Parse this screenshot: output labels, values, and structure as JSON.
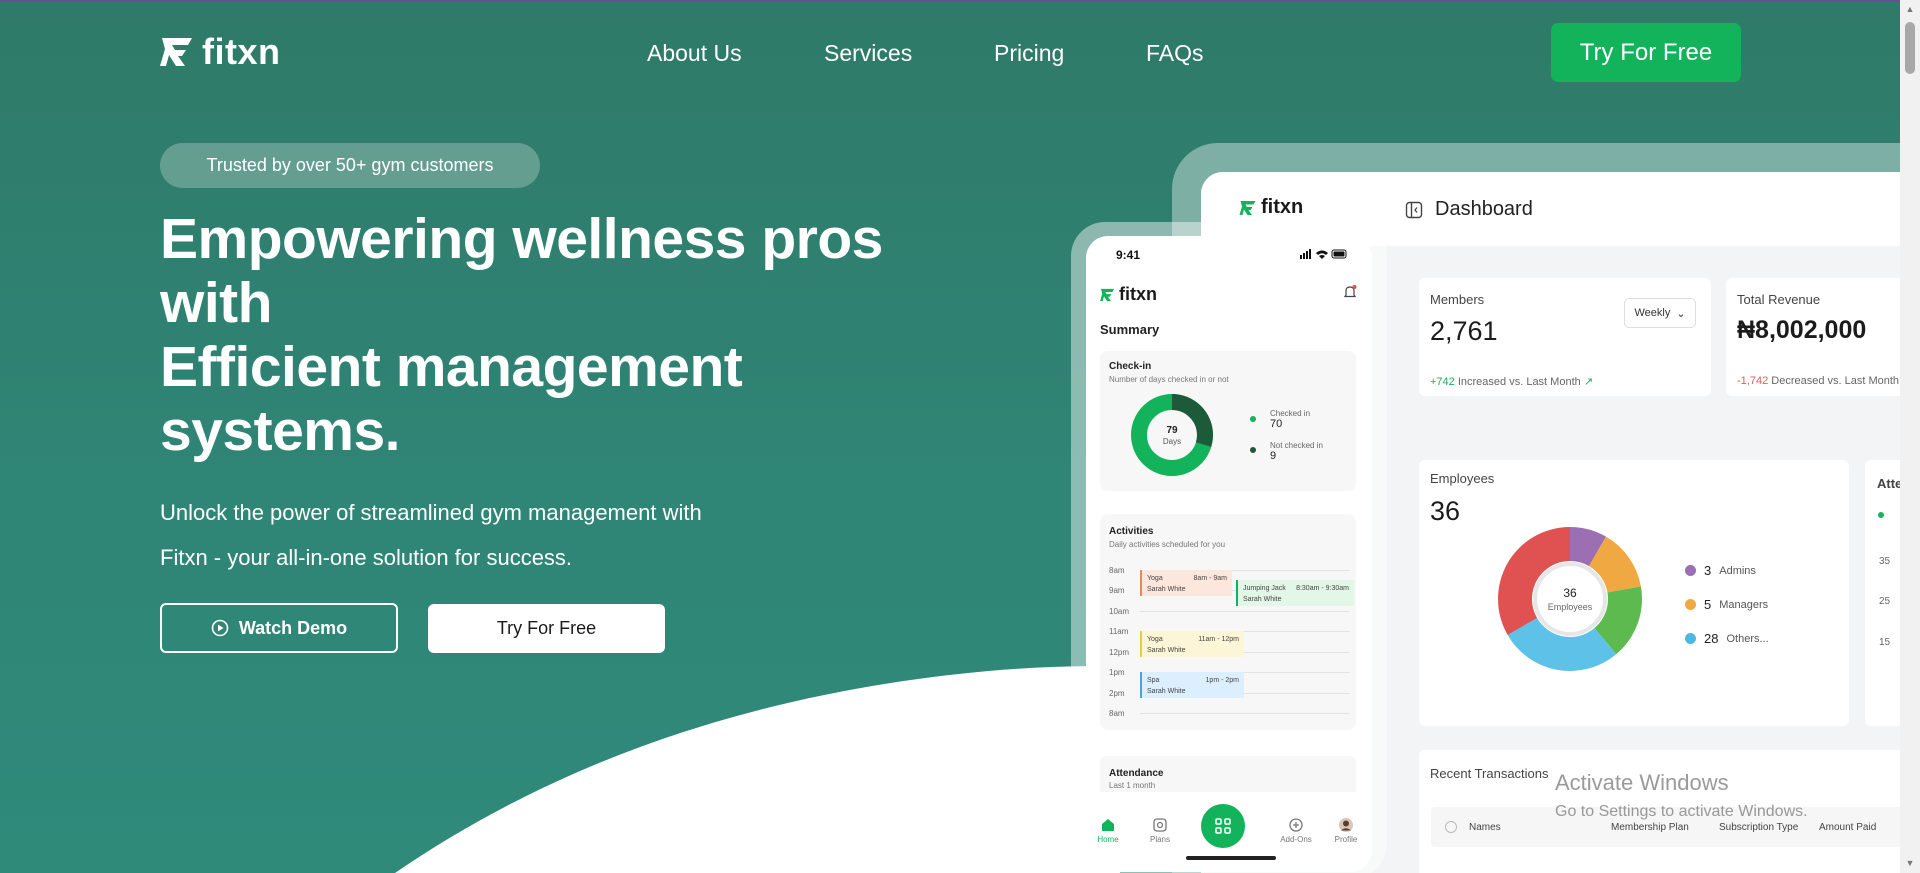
{
  "brand": {
    "name": "fitxn"
  },
  "nav": {
    "items": [
      "About Us",
      "Services",
      "Pricing",
      "FAQs"
    ],
    "cta": "Try For Free"
  },
  "hero": {
    "badge": "Trusted by over 50+ gym customers",
    "headline_1": "Empowering wellness pros",
    "headline_2": "with",
    "headline_3": "Efficient management",
    "headline_4": "systems.",
    "subtitle_1": "Unlock the power of streamlined gym management with",
    "subtitle_2": "Fitxn - your all-in-one solution for success.",
    "watch_demo": "Watch Demo",
    "try_free": "Try For Free"
  },
  "dashboard": {
    "title": "Dashboard",
    "members": {
      "label": "Members",
      "value": "2,761",
      "select": "Weekly",
      "delta": "+742",
      "delta_text": "Increased vs. Last Month"
    },
    "revenue": {
      "label": "Total Revenue",
      "value": "₦8,002,000",
      "delta": "-1,742",
      "delta_text": "Decreased vs. Last Month"
    },
    "employees": {
      "label": "Employees",
      "value": "36",
      "center_value": "36",
      "center_label": "Employees",
      "legend": [
        {
          "count": "3",
          "label": "Admins",
          "color": "#9b6fb2"
        },
        {
          "count": "5",
          "label": "Managers",
          "color": "#f0a942"
        },
        {
          "count": "28",
          "label": "Others...",
          "color": "#4fb8e0"
        }
      ],
      "segments": [
        {
          "value": 3,
          "color": "#9b6fb2"
        },
        {
          "value": 5,
          "color": "#f0a942"
        },
        {
          "value": 6,
          "color": "#5cba4f"
        },
        {
          "value": 10,
          "color": "#5ec1e8"
        },
        {
          "value": 12,
          "color": "#e05252"
        }
      ]
    },
    "attendance": {
      "label_partial": "Atte",
      "ticks": [
        "35",
        "25",
        "15"
      ]
    },
    "transactions": {
      "label": "Recent Transactions",
      "headers": [
        "Names",
        "Membership Plan",
        "Subscription Type",
        "Amount Paid"
      ]
    }
  },
  "phone": {
    "time": "9:41",
    "summary": "Summary",
    "checkin": {
      "title": "Check-in",
      "subtitle": "Number of days checked in or not",
      "center_value": "79",
      "center_label": "Days",
      "checked_label": "Checked in",
      "checked_value": "70",
      "not_label": "Not checked in",
      "not_value": "9",
      "checked": 70,
      "not_checked": 9
    },
    "activities": {
      "title": "Activities",
      "subtitle": "Daily activities scheduled for you",
      "times": [
        "8am",
        "9am",
        "10am",
        "11am",
        "12pm",
        "1pm",
        "2pm",
        "8am"
      ],
      "events": [
        {
          "name": "Yoga",
          "time": "8am - 9am",
          "person": "Sarah White"
        },
        {
          "name": "Jumping Jack",
          "time": "8:30am - 9:30am",
          "person": "Sarah White"
        },
        {
          "name": "Yoga",
          "time": "11am - 12pm",
          "person": "Sarah White"
        },
        {
          "name": "Spa",
          "time": "1pm - 2pm",
          "person": "Sarah White"
        }
      ]
    },
    "attendance": {
      "title": "Attendance",
      "subtitle": "Last 1 month"
    },
    "tabs": [
      "Home",
      "Plans",
      "Add-Ons",
      "Profile"
    ]
  },
  "watermark": {
    "line1": "Activate Windows",
    "line2": "Go to Settings to activate Windows."
  }
}
